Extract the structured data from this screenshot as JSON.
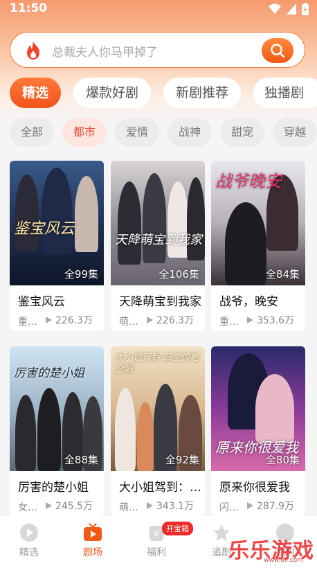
{
  "status": {
    "time": "11:50"
  },
  "search": {
    "placeholder": "总裁夫人你马甲掉了"
  },
  "tabs": [
    "精选",
    "爆款好剧",
    "新剧推荐",
    "独播剧"
  ],
  "filters": [
    "全部",
    "都市",
    "爱情",
    "战神",
    "甜宠",
    "穿越"
  ],
  "cards": [
    {
      "poster_title": "鉴宝风云",
      "episodes": "全99集",
      "name": "鉴宝风云",
      "genre": "重…",
      "views": "226.3万"
    },
    {
      "poster_title": "天降萌宝到我家",
      "episodes": "全106集",
      "name": "天降萌宝到我家",
      "genre": "萌…",
      "views": "226.3万"
    },
    {
      "poster_title": "战爷晚安",
      "episodes": "全84集",
      "name": "战爷，晚安",
      "genre": "重…",
      "views": "353.6万"
    },
    {
      "poster_title": "厉害的楚小姐",
      "episodes": "全88集",
      "name": "厉害的楚小姐",
      "genre": "女…",
      "views": "245.5万"
    },
    {
      "poster_title": "大小姐驾到 四宝惊艳全城",
      "episodes": "全92集",
      "name": "大小姐驾到：…",
      "genre": "萌…",
      "views": "343.1万"
    },
    {
      "poster_title": "原来你很爱我",
      "episodes": "全80集",
      "name": "原来你很爱我",
      "genre": "闪…",
      "views": "287.9万"
    }
  ],
  "bottom_nav": [
    "精选",
    "剧场",
    "福利",
    "追剧",
    "我的"
  ],
  "badge": "开宝箱",
  "watermark": {
    "main": "乐乐游戏",
    "sub": "www.6ll.com"
  },
  "colors": {
    "accent": "#f05a16",
    "active_filter": "#e8503a"
  }
}
